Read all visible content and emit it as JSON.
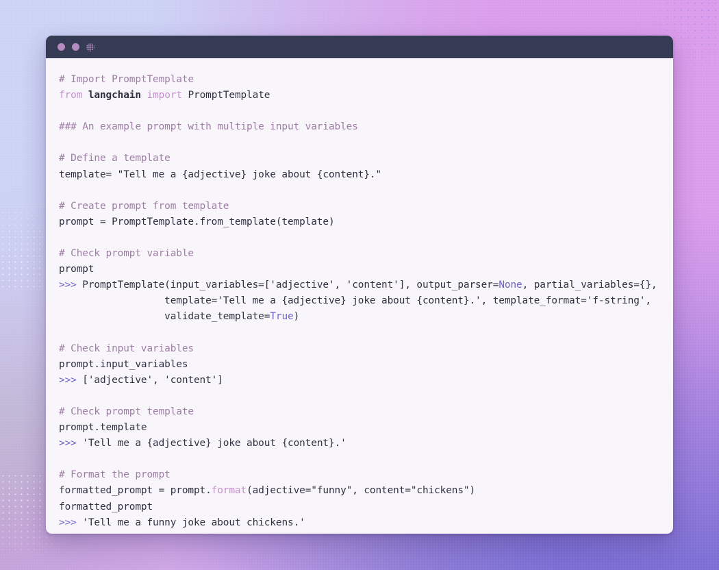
{
  "window": {
    "titlebar": {
      "dots": [
        {
          "name": "window-dot-close",
          "style": "solid",
          "color": "#b48bc0"
        },
        {
          "name": "window-dot-minimize",
          "style": "solid",
          "color": "#b48bc0"
        },
        {
          "name": "window-dot-maximize",
          "style": "pattern",
          "color": "#b48bc0"
        }
      ],
      "background": "#343b52"
    },
    "editor": {
      "background": "#f8f6fb",
      "language": "python",
      "theme_colors": {
        "text": "#2f3140",
        "comment": "#9e7da4",
        "keyword": "#c78fd0",
        "function": "#c78fd0",
        "constant": "#6f63c8",
        "output_marker": "#6f63c8"
      }
    }
  },
  "code": {
    "lines": [
      {
        "id": "l01",
        "text": "# Import PromptTemplate"
      },
      {
        "id": "l02",
        "text": "from langchain import PromptTemplate"
      },
      {
        "id": "l03",
        "text": ""
      },
      {
        "id": "l04",
        "text": "### An example prompt with multiple input variables"
      },
      {
        "id": "l05",
        "text": ""
      },
      {
        "id": "l06",
        "text": "# Define a template"
      },
      {
        "id": "l07",
        "text": "template= \"Tell me a {adjective} joke about {content}.\""
      },
      {
        "id": "l08",
        "text": ""
      },
      {
        "id": "l09",
        "text": "# Create prompt from template"
      },
      {
        "id": "l10",
        "text": "prompt = PromptTemplate.from_template(template)"
      },
      {
        "id": "l11",
        "text": ""
      },
      {
        "id": "l12",
        "text": "# Check prompt variable"
      },
      {
        "id": "l13",
        "text": "prompt"
      },
      {
        "id": "l14",
        "text": ">>> PromptTemplate(input_variables=['adjective', 'content'], output_parser=None, partial_variables={},"
      },
      {
        "id": "l15",
        "text": "                  template='Tell me a {adjective} joke about {content}.', template_format='f-string',"
      },
      {
        "id": "l16",
        "text": "                  validate_template=True)"
      },
      {
        "id": "l17",
        "text": ""
      },
      {
        "id": "l18",
        "text": "# Check input variables"
      },
      {
        "id": "l19",
        "text": "prompt.input_variables"
      },
      {
        "id": "l20",
        "text": ">>> ['adjective', 'content']"
      },
      {
        "id": "l21",
        "text": ""
      },
      {
        "id": "l22",
        "text": "# Check prompt template"
      },
      {
        "id": "l23",
        "text": "prompt.template"
      },
      {
        "id": "l24",
        "text": ">>> 'Tell me a {adjective} joke about {content}.'"
      },
      {
        "id": "l25",
        "text": ""
      },
      {
        "id": "l26",
        "text": "# Format the prompt"
      },
      {
        "id": "l27",
        "text": "formatted_prompt = prompt.format(adjective=\"funny\", content=\"chickens\")"
      },
      {
        "id": "l28",
        "text": "formatted_prompt"
      },
      {
        "id": "l29",
        "text": ">>> 'Tell me a funny joke about chickens.'"
      }
    ]
  },
  "background": {
    "colors": {
      "top_left": "#ccd3f5",
      "top_right": "#dc9cec",
      "bottom_left": "#bcaac6",
      "bottom_right": "#7b6fd4",
      "mid": "#c3a2d9"
    }
  }
}
